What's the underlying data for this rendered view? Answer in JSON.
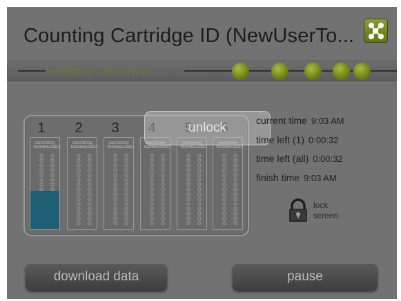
{
  "header": {
    "title": "Counting Cartridge ID (NewUserTo...",
    "network_icon": "network-icon"
  },
  "banner": {
    "brand": "NanoString",
    "reg": "®",
    "suffix": " Life Sciences",
    "accent_color": "#7a8f1e"
  },
  "cartridge": {
    "lanes": [
      {
        "number": "1",
        "label_top": "nanoString",
        "label_sub": "TECHNOLOGIES",
        "progress": 0.42
      },
      {
        "number": "2",
        "label_top": "nanoString",
        "label_sub": "TECHNOLOGIES",
        "progress": 0
      },
      {
        "number": "3",
        "label_top": "nanoString",
        "label_sub": "TECHNOLOGIES",
        "progress": 0
      },
      {
        "number": "4",
        "label_top": "nanoString",
        "label_sub": "TECHNOLOGIES",
        "progress": 0
      },
      {
        "number": "5",
        "label_top": "nanoString",
        "label_sub": "TECHNOLOGIES",
        "progress": 0
      },
      {
        "number": "6",
        "label_top": "nanoString",
        "label_sub": "TECHNOLOGIES",
        "progress": 0
      }
    ],
    "fill_color": "#1d5e74"
  },
  "unlock": {
    "label": "unlock"
  },
  "status": {
    "current_time_label": "current time",
    "current_time_value": "9:03 AM",
    "time_left_one_label": "time left (1)",
    "time_left_one_value": "0:00:32",
    "time_left_all_label": "time left (all)",
    "time_left_all_value": "0:00:32",
    "finish_time_label": "finish time",
    "finish_time_value": "9:03 AM"
  },
  "lock": {
    "icon": "padlock-icon",
    "line1": "lock",
    "line2": "screen"
  },
  "buttons": {
    "download": "download data",
    "pause": "pause"
  }
}
